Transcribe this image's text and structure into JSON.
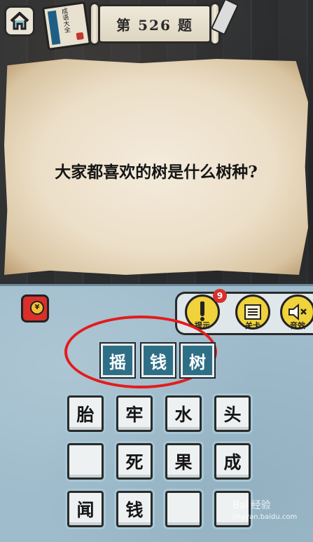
{
  "header": {
    "level_title": "第 526 题",
    "book_title": "成语大全"
  },
  "question": {
    "text": "大家都喜欢的树是什么树种?"
  },
  "tools": [
    {
      "label": "提示",
      "icon": "exclamation-icon",
      "badge": "9"
    },
    {
      "label": "关卡",
      "icon": "scroll-icon"
    },
    {
      "label": "音效",
      "icon": "speaker-mute-icon"
    }
  ],
  "redpacket": {
    "symbol": "¥"
  },
  "answer": [
    "摇",
    "钱",
    "树"
  ],
  "options": [
    [
      "胎",
      "牢",
      "水",
      "头"
    ],
    [
      "",
      "死",
      "果",
      "成"
    ],
    [
      "闻",
      "钱",
      "",
      ""
    ]
  ],
  "watermark": {
    "text": "Bai 经验",
    "url": "jingyan.baidu.com"
  },
  "colors": {
    "highlight_ring": "#e31c1c",
    "answer_tile": "#2e6f86",
    "tool_yellow": "#f0d23a"
  }
}
